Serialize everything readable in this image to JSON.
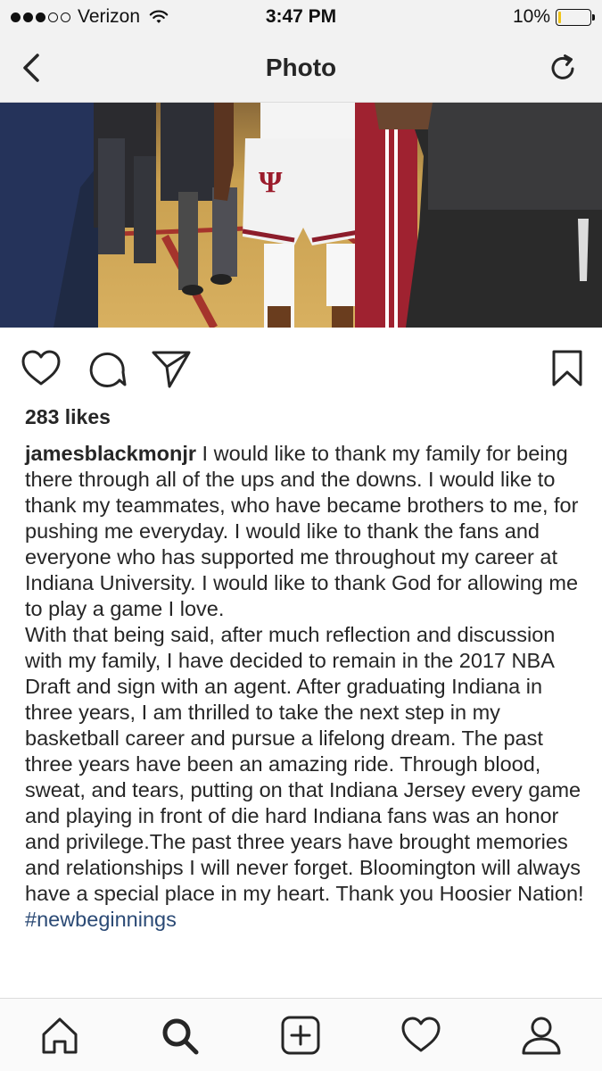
{
  "status_bar": {
    "carrier": "Verizon",
    "time": "3:47 PM",
    "battery_percent": "10%",
    "battery_level": 0.1,
    "signal_bars_filled": 3,
    "signal_bars_total": 5,
    "battery_color": "#f0c419"
  },
  "nav": {
    "title": "Photo",
    "back_icon": "chevron-left-icon",
    "refresh_icon": "refresh-icon"
  },
  "post": {
    "likes": "283 likes",
    "username": "jamesblackmonjr",
    "caption_paragraph_1": " I would like to thank my family for being there through all of the ups and the downs. I would like to thank my teammates, who have became brothers to me, for pushing me everyday. I would like to thank the fans and everyone who has supported me throughout my career at Indiana University. I would like to thank God for allowing me to play a game I love.",
    "caption_paragraph_2": "With that being said, after much reflection and discussion with my family, I have decided to remain in the 2017 NBA Draft and sign with an agent. After graduating Indiana in three years, I am thrilled to take the next step in my basketball career and pursue a lifelong dream. The past three years have been an amazing ride. Through blood, sweat, and tears, putting on that Indiana Jersey every game and playing in front of die hard Indiana fans was an honor and privilege.The past three years have brought memories and relationships I will never forget. Bloomington will always have a special place in my heart. Thank you Hoosier Nation! ",
    "hashtag": "#newbeginnings",
    "hashtag_color": "#2b4a75"
  },
  "actions": [
    "heart-icon",
    "comment-icon",
    "share-icon",
    "bookmark-icon"
  ],
  "tabs": [
    "home-icon",
    "search-icon",
    "add-post-icon",
    "activity-heart-icon",
    "profile-icon"
  ]
}
